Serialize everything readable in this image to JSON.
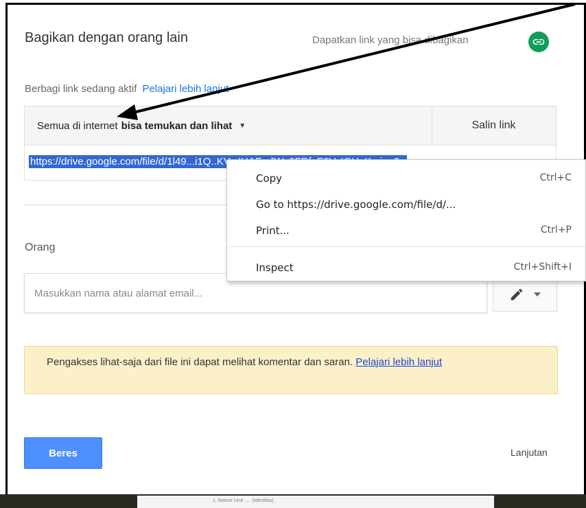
{
  "dialog": {
    "title": "Bagikan dengan orang lain",
    "get_link_label": "Dapatkan link yang bisa dibagikan",
    "link_status": "Berbagi link sedang aktif",
    "learn_more": "Pelajari lebih lanjut",
    "access_prefix": "Semua di internet",
    "access_bold": "bisa temukan dan lihat",
    "copy_link": "Salin link",
    "url": "https://drive.google.com/file/d/1l49...i1Q..KV...IHAF...JW..0FRf..F0V..IOU..K...ine9..",
    "people_label": "Orang",
    "people_placeholder": "Masukkan nama atau alamat email...",
    "notice_text": "Pengakses lihat-saja dari file ini dapat melihat komentar dan saran.",
    "notice_link": "Pelajari lebih lanjut",
    "done_button": "Beres",
    "advanced_link": "Lanjutan"
  },
  "context_menu": {
    "items": [
      {
        "label": "Copy",
        "shortcut": "Ctrl+C"
      },
      {
        "label": "Go to https://drive.google.com/file/d/...",
        "shortcut": ""
      },
      {
        "label": "Print...",
        "shortcut": "Ctrl+P"
      },
      {
        "label": "Inspect",
        "shortcut": "Ctrl+Shift+I"
      }
    ]
  },
  "colors": {
    "accent": "#4d90fe",
    "link": "#1a73e8",
    "link_icon_bg": "#0f9d58",
    "notice_bg": "#fcf0c9",
    "selection": "#3367d6"
  },
  "icons": [
    "link-icon",
    "caret-down-icon",
    "pencil-icon",
    "chevron-down-icon",
    "arrow-annotation"
  ]
}
